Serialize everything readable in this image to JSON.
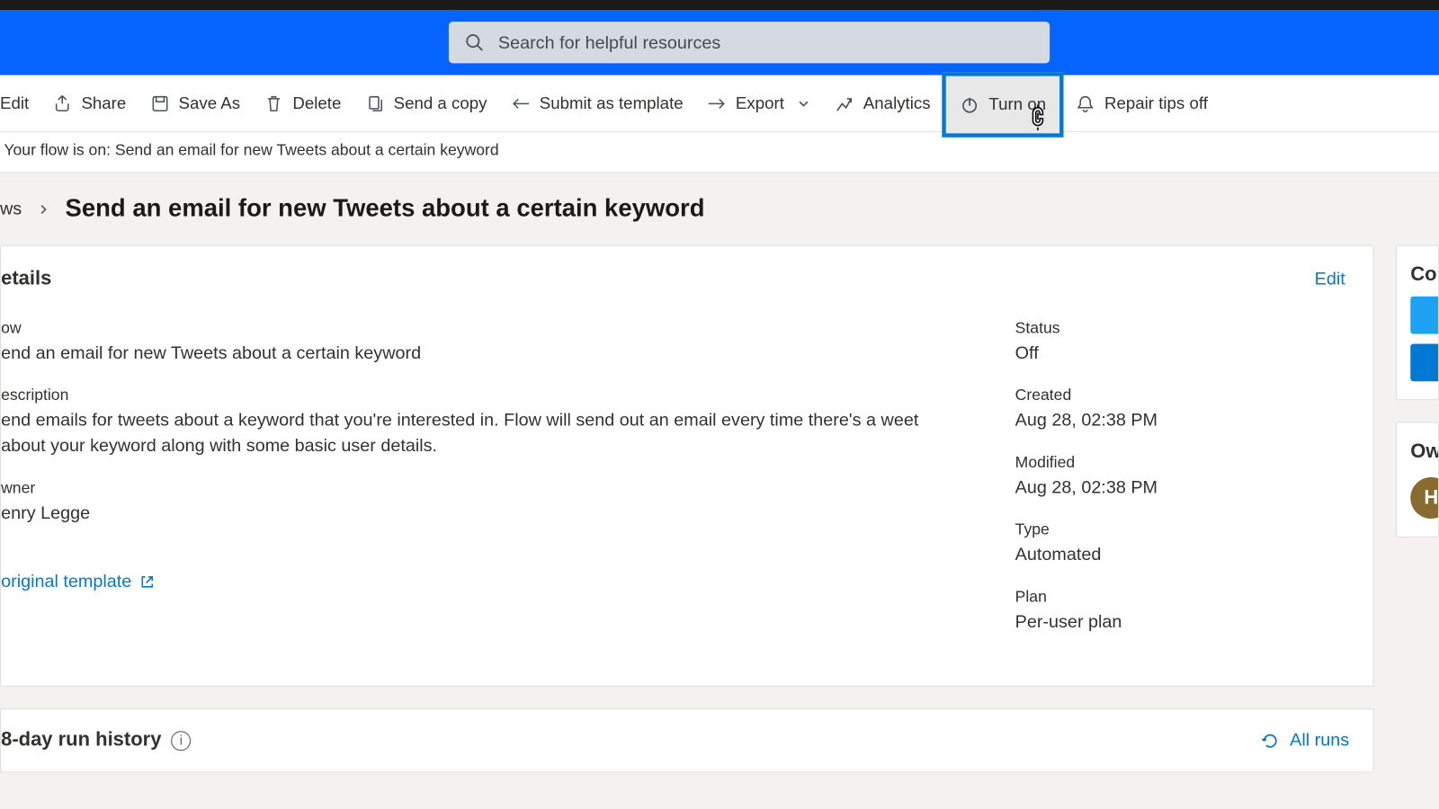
{
  "search": {
    "placeholder": "Search for helpful resources"
  },
  "toolbar": {
    "edit": "Edit",
    "share": "Share",
    "saveas": "Save As",
    "delete": "Delete",
    "sendcopy": "Send a copy",
    "submit": "Submit as template",
    "export": "Export",
    "analytics": "Analytics",
    "turnon": "Turn on",
    "repair": "Repair tips off"
  },
  "notice": "Your flow is on: Send an email for new Tweets about a certain keyword",
  "breadcrumb": {
    "root": "ws",
    "title": "Send an email for new Tweets about a certain keyword"
  },
  "details": {
    "heading": "etails",
    "edit": "Edit",
    "flow": {
      "label": "ow",
      "value": "end an email for new Tweets about a certain keyword"
    },
    "description": {
      "label": "escription",
      "value": "end emails for tweets about a keyword that you're interested in. Flow will send out an email every time there's a weet about your keyword along with some basic user details."
    },
    "owner": {
      "label": "wner",
      "value": "enry Legge"
    },
    "status": {
      "label": "Status",
      "value": "Off"
    },
    "created": {
      "label": "Created",
      "value": "Aug 28, 02:38 PM"
    },
    "modified": {
      "label": "Modified",
      "value": "Aug 28, 02:38 PM"
    },
    "type": {
      "label": "Type",
      "value": "Automated"
    },
    "plan": {
      "label": "Plan",
      "value": "Per-user plan"
    },
    "template": "original template"
  },
  "side": {
    "connections": "Co",
    "owners": "Ow",
    "avatar": "H"
  },
  "runhistory": {
    "title": "8-day run history",
    "allruns": "All runs"
  }
}
